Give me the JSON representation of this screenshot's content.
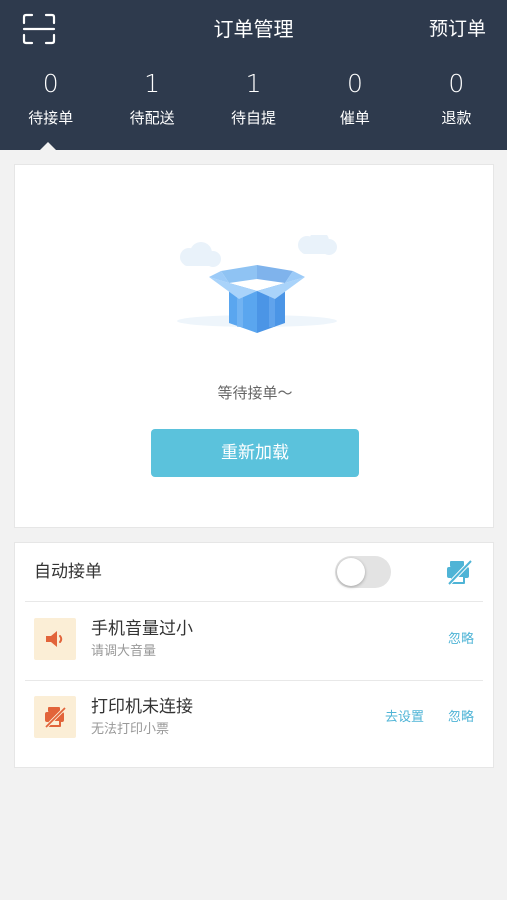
{
  "header": {
    "title": "订单管理",
    "preorder_label": "预订单"
  },
  "tabs": [
    {
      "count": "0",
      "label": "待接单",
      "active": true
    },
    {
      "count": "1",
      "label": "待配送"
    },
    {
      "count": "1",
      "label": "待自提"
    },
    {
      "count": "0",
      "label": "催单"
    },
    {
      "count": "0",
      "label": "退款"
    }
  ],
  "empty_state": {
    "message": "等待接单～",
    "reload_label": "重新加载"
  },
  "auto_accept": {
    "label": "自动接单",
    "enabled": false
  },
  "alerts": [
    {
      "title": "手机音量过小",
      "subtitle": "请调大音量",
      "ignore_label": "忽略"
    },
    {
      "title": "打印机未连接",
      "subtitle": "无法打印小票",
      "settings_label": "去设置",
      "ignore_label": "忽略"
    }
  ],
  "colors": {
    "header_bg": "#2e3a4d",
    "accent": "#5bc2dc",
    "link": "#4fb4d6",
    "alert_icon_bg": "#fbeed6",
    "alert_icon": "#e2643a"
  }
}
